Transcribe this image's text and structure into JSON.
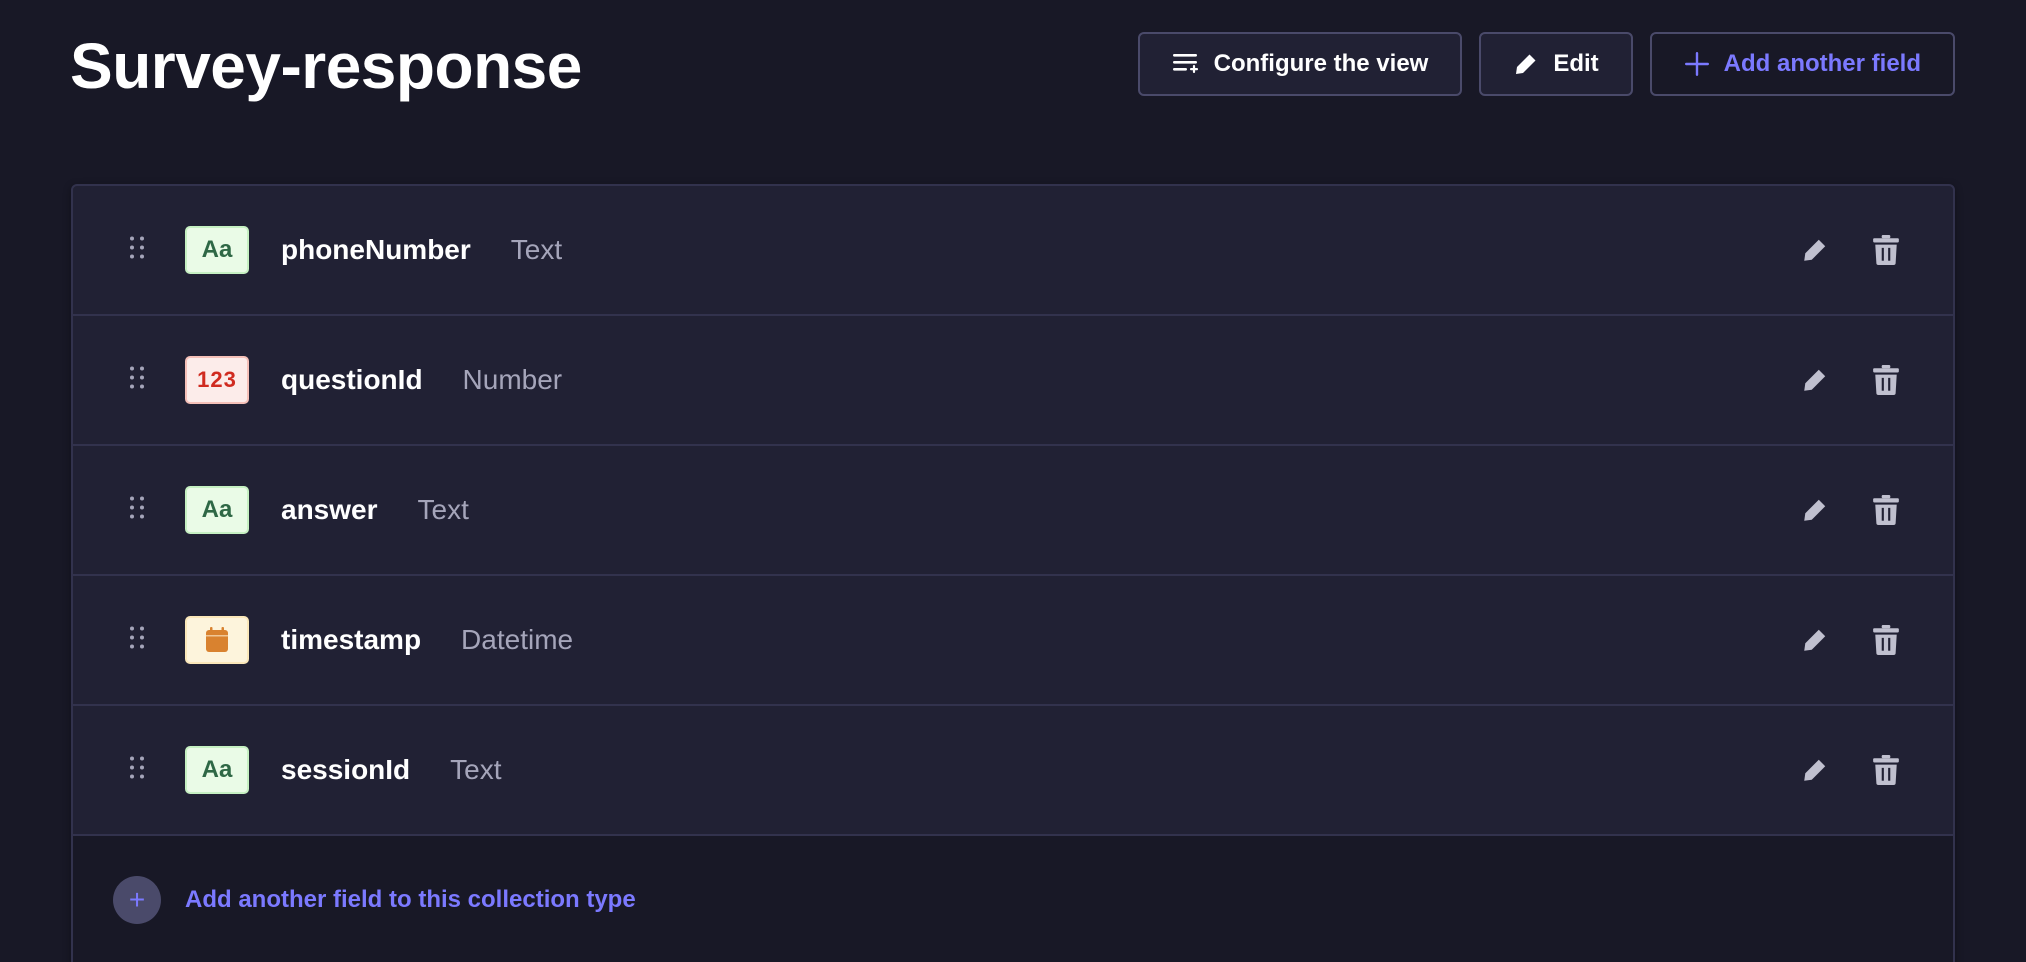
{
  "header": {
    "title": "Survey-response",
    "configure_label": "Configure the view",
    "edit_label": "Edit",
    "add_field_label": "Add another field"
  },
  "fields": [
    {
      "name": "phoneNumber",
      "type": "Text",
      "icon": "text-type-icon",
      "badge": "Aa",
      "color": "#2f6846"
    },
    {
      "name": "questionId",
      "type": "Number",
      "icon": "number-type-icon",
      "badge": "123",
      "color": "#d02b20"
    },
    {
      "name": "answer",
      "type": "Text",
      "icon": "text-type-icon",
      "badge": "Aa",
      "color": "#2f6846"
    },
    {
      "name": "timestamp",
      "type": "Datetime",
      "icon": "calendar-icon",
      "badge": "",
      "color": "#d9822f"
    },
    {
      "name": "sessionId",
      "type": "Text",
      "icon": "text-type-icon",
      "badge": "Aa",
      "color": "#2f6846"
    }
  ],
  "footer": {
    "add_label": "Add another field to this collection type",
    "add_symbol": "+"
  },
  "colors": {
    "background": "#181826",
    "panel": "#212134",
    "accent": "#7b79ff",
    "muted_text": "#a5a5ba"
  }
}
